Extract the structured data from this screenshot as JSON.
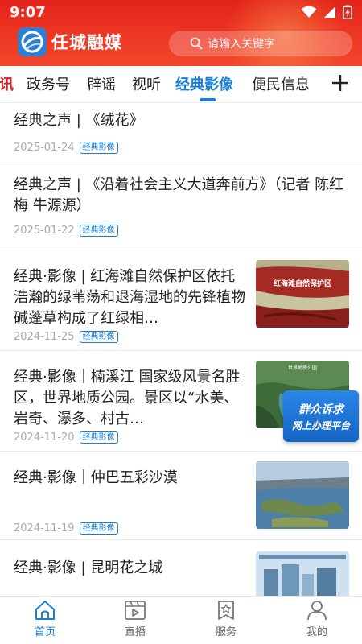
{
  "status_bar": {
    "time": "9:07"
  },
  "header": {
    "app_name": "任城融媒",
    "search_placeholder": "请输入关键字"
  },
  "tabs": {
    "items": [
      {
        "label": "讯"
      },
      {
        "label": "政务号"
      },
      {
        "label": "辟谣"
      },
      {
        "label": "视听"
      },
      {
        "label": "经典影像"
      },
      {
        "label": "便民信息"
      }
    ],
    "active": "经典影像"
  },
  "feed": {
    "items": [
      {
        "title": "经典之声 | 《绒花》",
        "date": "2025-01-24",
        "tag": "经典影像"
      },
      {
        "title": "经典之声 | 《沿着社会主义大道奔前方》（记者 陈红梅  牛源源）",
        "date": "2025-01-22",
        "tag": "经典影像"
      },
      {
        "title": "经典·影像 | 红海滩自然保护区依托浩瀚的绿苇荡和退海湿地的先锋植物碱蓬草构成了红绿相…",
        "date": "2024-11-25",
        "tag": "经典影像",
        "thumb_caption": "红海滩自然保护区"
      },
      {
        "title": "经典·影像｜楠溪江  国家级风景名胜区，世界地质公园。景区以“水美、岩奇、瀑多、村古…",
        "date": "2024-11-20",
        "tag": "经典影像",
        "thumb_caption": "世界地质公园"
      },
      {
        "title": "经典·影像｜仲巴五彩沙漠",
        "date": "2024-11-19",
        "tag": "经典影像"
      },
      {
        "title": "经典·影像 | 昆明花之城",
        "date": "",
        "tag": ""
      }
    ]
  },
  "float_banner": {
    "line1": "群众诉求",
    "line2": "网上办理平台"
  },
  "bottom_nav": {
    "items": [
      {
        "label": "首页",
        "icon": "home-icon"
      },
      {
        "label": "直播",
        "icon": "live-icon"
      },
      {
        "label": "服务",
        "icon": "service-icon"
      },
      {
        "label": "我的",
        "icon": "profile-icon"
      }
    ],
    "active": "首页"
  },
  "colors": {
    "header_red": "#e3231b",
    "accent_blue": "#1a7fd4",
    "date_gray": "#aaaaaa"
  }
}
